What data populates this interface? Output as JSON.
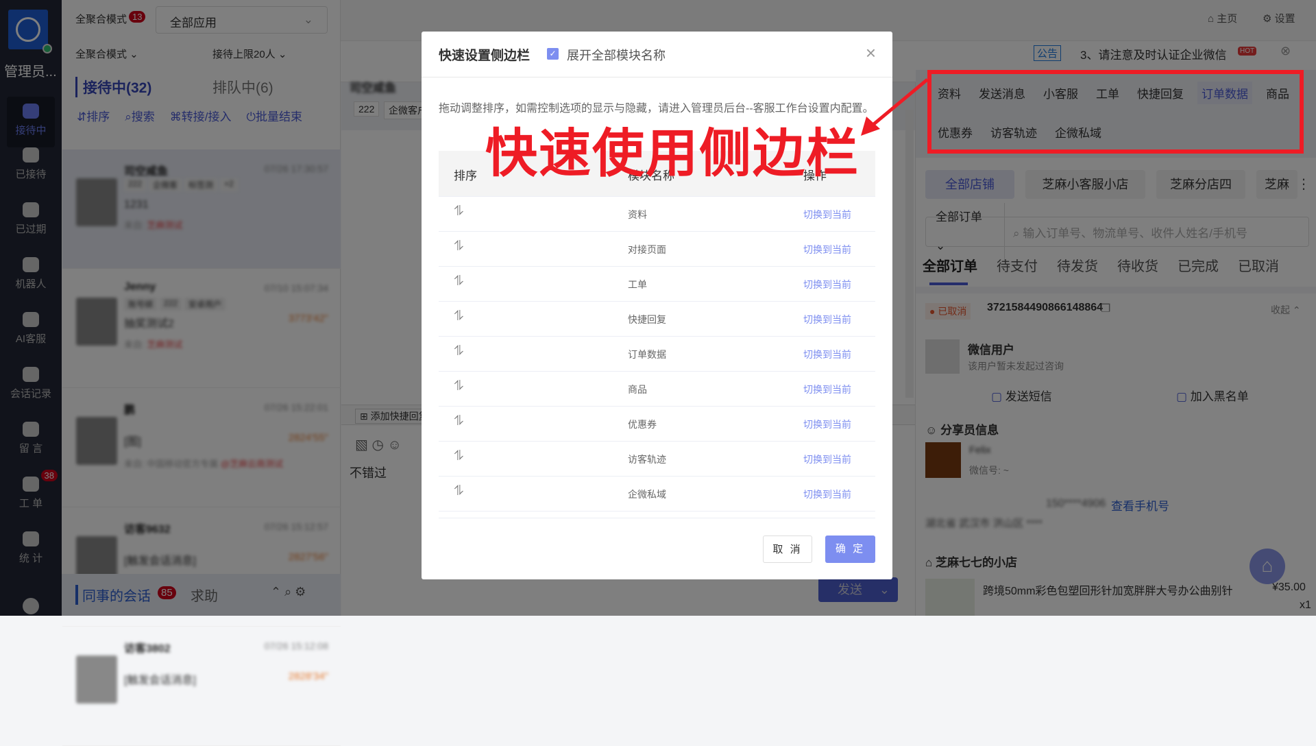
{
  "sidebar": {
    "admin": "管理员...",
    "items": [
      {
        "label": "接待中",
        "active": true
      },
      {
        "label": "已接待"
      },
      {
        "label": "已过期"
      },
      {
        "label": "机器人"
      },
      {
        "label": "AI客服"
      },
      {
        "label": "会话记录"
      },
      {
        "label": "留 言"
      },
      {
        "label": "工 单",
        "badge": "38"
      },
      {
        "label": "统 计"
      }
    ]
  },
  "top": {
    "mode": "全聚合模式",
    "mode_badge": "13",
    "app_select": "全部应用",
    "home": "主页",
    "settings": "设置",
    "mode_select": "全聚合模式",
    "limit_select": "接待上限20人",
    "notice_tag": "公告",
    "notice": "3、请注意及时认证企业微信",
    "hot": "HOT"
  },
  "list": {
    "tab_active": "接待中(32)",
    "tab_queue": "排队中(6)",
    "actions": [
      "排序",
      "搜索",
      "转接/接入",
      "批量结束"
    ],
    "items": [
      {
        "name": "司空咸鱼",
        "time": "07/26 17:30:57",
        "tags": [
          "222",
          "企微客",
          "标签测",
          "+2"
        ],
        "msg": "1231",
        "from": "来自:",
        "src": "芝麻测试"
      },
      {
        "name": "Jenny",
        "time": "07/10 15:07:34",
        "tags": [
          "账号绑",
          "222",
          "安卓用户"
        ],
        "msg": "抽奖测试2",
        "dur": "3773'42\"",
        "from": "来自:",
        "src": "芝麻测试"
      },
      {
        "name": "鹏",
        "time": "07/26 15:22:01",
        "msg": "[图]",
        "dur": "2824'55\"",
        "from": "来自: 中国移动官方专属",
        "src": "@芝麻云商测试"
      },
      {
        "name": "访客9632",
        "time": "07/26 15:12:57",
        "msg": "[触发会话消息]",
        "dur": "2827'56\"",
        "from": "来自: 中国移动官方专属",
        "src": "@芝麻云商测试"
      },
      {
        "name": "访客3802",
        "time": "07/26 15:12:08",
        "msg": "[触发会话消息]",
        "dur": "2828'34\""
      }
    ],
    "colleague": "同事的会话",
    "colleague_badge": "85",
    "help": "求助"
  },
  "chat": {
    "name": "司空咸鱼",
    "tags": [
      "222",
      "企微客户"
    ],
    "add_quick": "添加快捷回复",
    "draft": "不错过",
    "send": "发送"
  },
  "right": {
    "tabs_row1": [
      "资料",
      "发送消息",
      "小客服",
      "工单",
      "快捷回复",
      "订单数据",
      "商品"
    ],
    "tabs_row2": [
      "优惠券",
      "访客轨迹",
      "企微私域"
    ],
    "active_tab": "订单数据",
    "stores": [
      "全部店铺",
      "芝麻小客服小店",
      "芝麻分店四",
      "芝麻"
    ],
    "order_filter": "全部订单",
    "search_placeholder": "输入订单号、物流单号、收件人姓名/手机号",
    "order_tabs": [
      "全部订单",
      "待支付",
      "待发货",
      "待收货",
      "已完成",
      "已取消"
    ],
    "order_status": "已取消",
    "order_no": "3721584490866148864",
    "collapse": "收起",
    "user_name": "微信用户",
    "user_sub": "该用户暂未发起过咨询",
    "send_sms": "发送短信",
    "blacklist": "加入黑名单",
    "sharer_title": "分享员信息",
    "sharer_name": "Felix",
    "sharer_wx": "微信号: ~",
    "phone": "150****4906",
    "view_phone": "查看手机号",
    "address": "湖北省 武汉市 洪山区 ****",
    "shop": "芝麻七七的小店",
    "product": "跨境50mm彩色包塑回形针加宽胖胖大号办公曲别针",
    "price": "¥35.00",
    "qty": "x1"
  },
  "modal": {
    "title": "快速设置侧边栏",
    "expand_label": "展开全部模块名称",
    "expand_checked": true,
    "desc": "拖动调整排序，如需控制选项的显示与隐藏，请进入管理员后台--客服工作台设置内配置。",
    "headers": [
      "排序",
      "模块名称",
      "操作"
    ],
    "rows": [
      "资料",
      "对接页面",
      "工单",
      "快捷回复",
      "订单数据",
      "商品",
      "优惠券",
      "访客轨迹",
      "企微私域"
    ],
    "action": "切换到当前",
    "cancel": "取 消",
    "ok": "确 定"
  },
  "annotation": {
    "text": "快速使用侧边栏",
    "color": "#ee1c25"
  },
  "colors": {
    "accent": "#7d8ef0",
    "sidebar": "#222636",
    "logo": "#1f5fd6"
  }
}
